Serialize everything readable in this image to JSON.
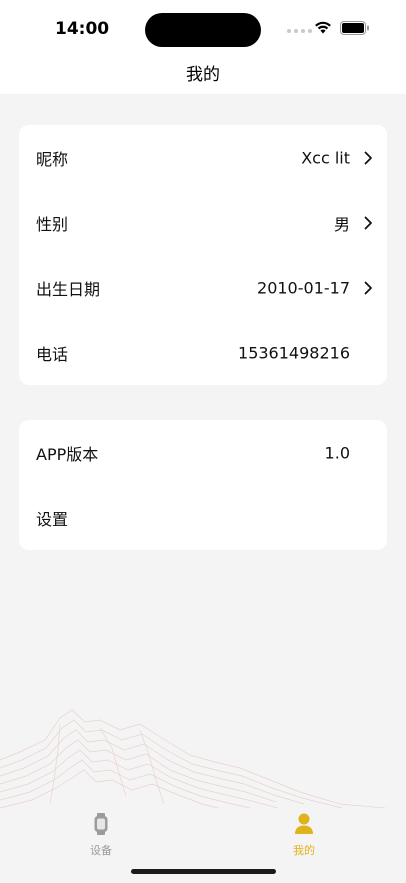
{
  "status_bar": {
    "time": "14:00"
  },
  "nav": {
    "title": "我的"
  },
  "profile": {
    "rows": [
      {
        "label": "昵称",
        "value": "Xcc lit"
      },
      {
        "label": "性别",
        "value": "男"
      },
      {
        "label": "出生日期",
        "value": "2010-01-17"
      },
      {
        "label": "电话",
        "value": "15361498216"
      }
    ]
  },
  "app_info": {
    "rows": [
      {
        "label": "APP版本",
        "value": "1.0"
      },
      {
        "label": "设置",
        "value": ""
      }
    ]
  },
  "tab_bar": {
    "items": [
      {
        "label": "设备",
        "icon": "watch-icon",
        "active": false
      },
      {
        "label": "我的",
        "icon": "person-icon",
        "active": true
      }
    ]
  },
  "colors": {
    "background": "#f4f4f4",
    "card": "#ffffff",
    "accent": "#e2b21c",
    "inactive": "#9b9b9b"
  }
}
